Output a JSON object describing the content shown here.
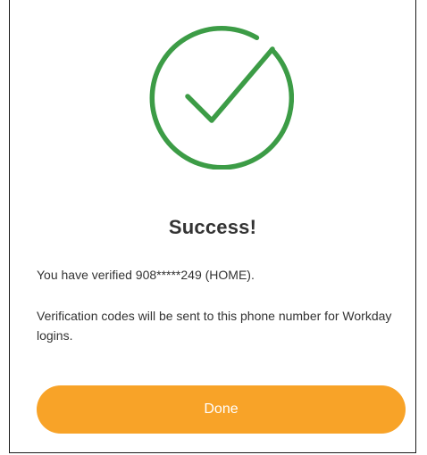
{
  "dialog": {
    "icon": "success-checkmark-icon",
    "title": "Success!",
    "verified_message": "You have verified 908*****249 (HOME).",
    "info_message": "Verification codes will be sent to this phone number for Workday logins.",
    "done_label": "Done"
  },
  "colors": {
    "success_green": "#3c9c46",
    "button_orange": "#f8a328",
    "text": "#333333"
  }
}
